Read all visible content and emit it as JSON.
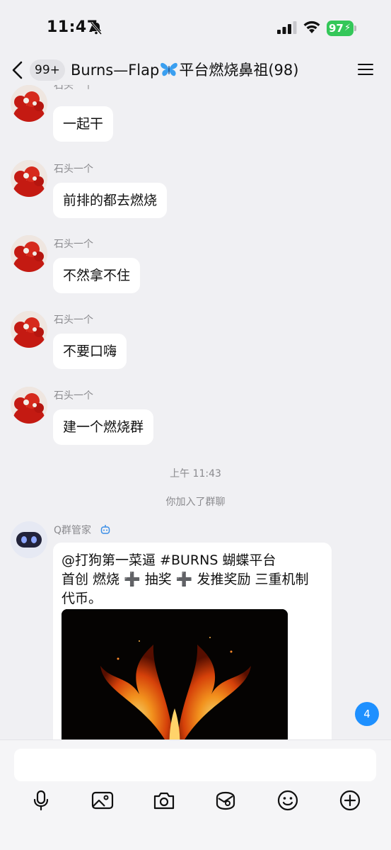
{
  "status_bar": {
    "time": "11:47",
    "battery": "97"
  },
  "nav": {
    "back_count": "99+",
    "title_prefix": "Burns—Flap",
    "title_suffix": "平台燃烧鼻祖(98)"
  },
  "messages": [
    {
      "sender": "石头一个",
      "text": "一起干"
    },
    {
      "sender": "石头一个",
      "text": "前排的都去燃烧"
    },
    {
      "sender": "石头一个",
      "text": "不然拿不住"
    },
    {
      "sender": "石头一个",
      "text": "不要口嗨"
    },
    {
      "sender": "石头一个",
      "text": "建一个燃烧群"
    }
  ],
  "time_separator": "上午 11:43",
  "system_note": "你加入了群聊",
  "bot_message": {
    "sender": "Q群管家",
    "text": "@打狗第一菜逼 #BURNS  蝴蝶平台\n首创  燃烧 ➕ 抽奖 ➕ 发推奖励 三重机制\n代币。"
  },
  "new_message_count": "4",
  "input": {
    "value": "",
    "placeholder": ""
  },
  "toolbar": [
    "microphone-icon",
    "image-icon",
    "camera-icon",
    "red-packet-icon",
    "emoji-icon",
    "plus-icon"
  ],
  "colors": {
    "background": "#f0f0f3",
    "bubble": "#ffffff",
    "accent": "#1e90ff",
    "battery": "#34c759"
  }
}
